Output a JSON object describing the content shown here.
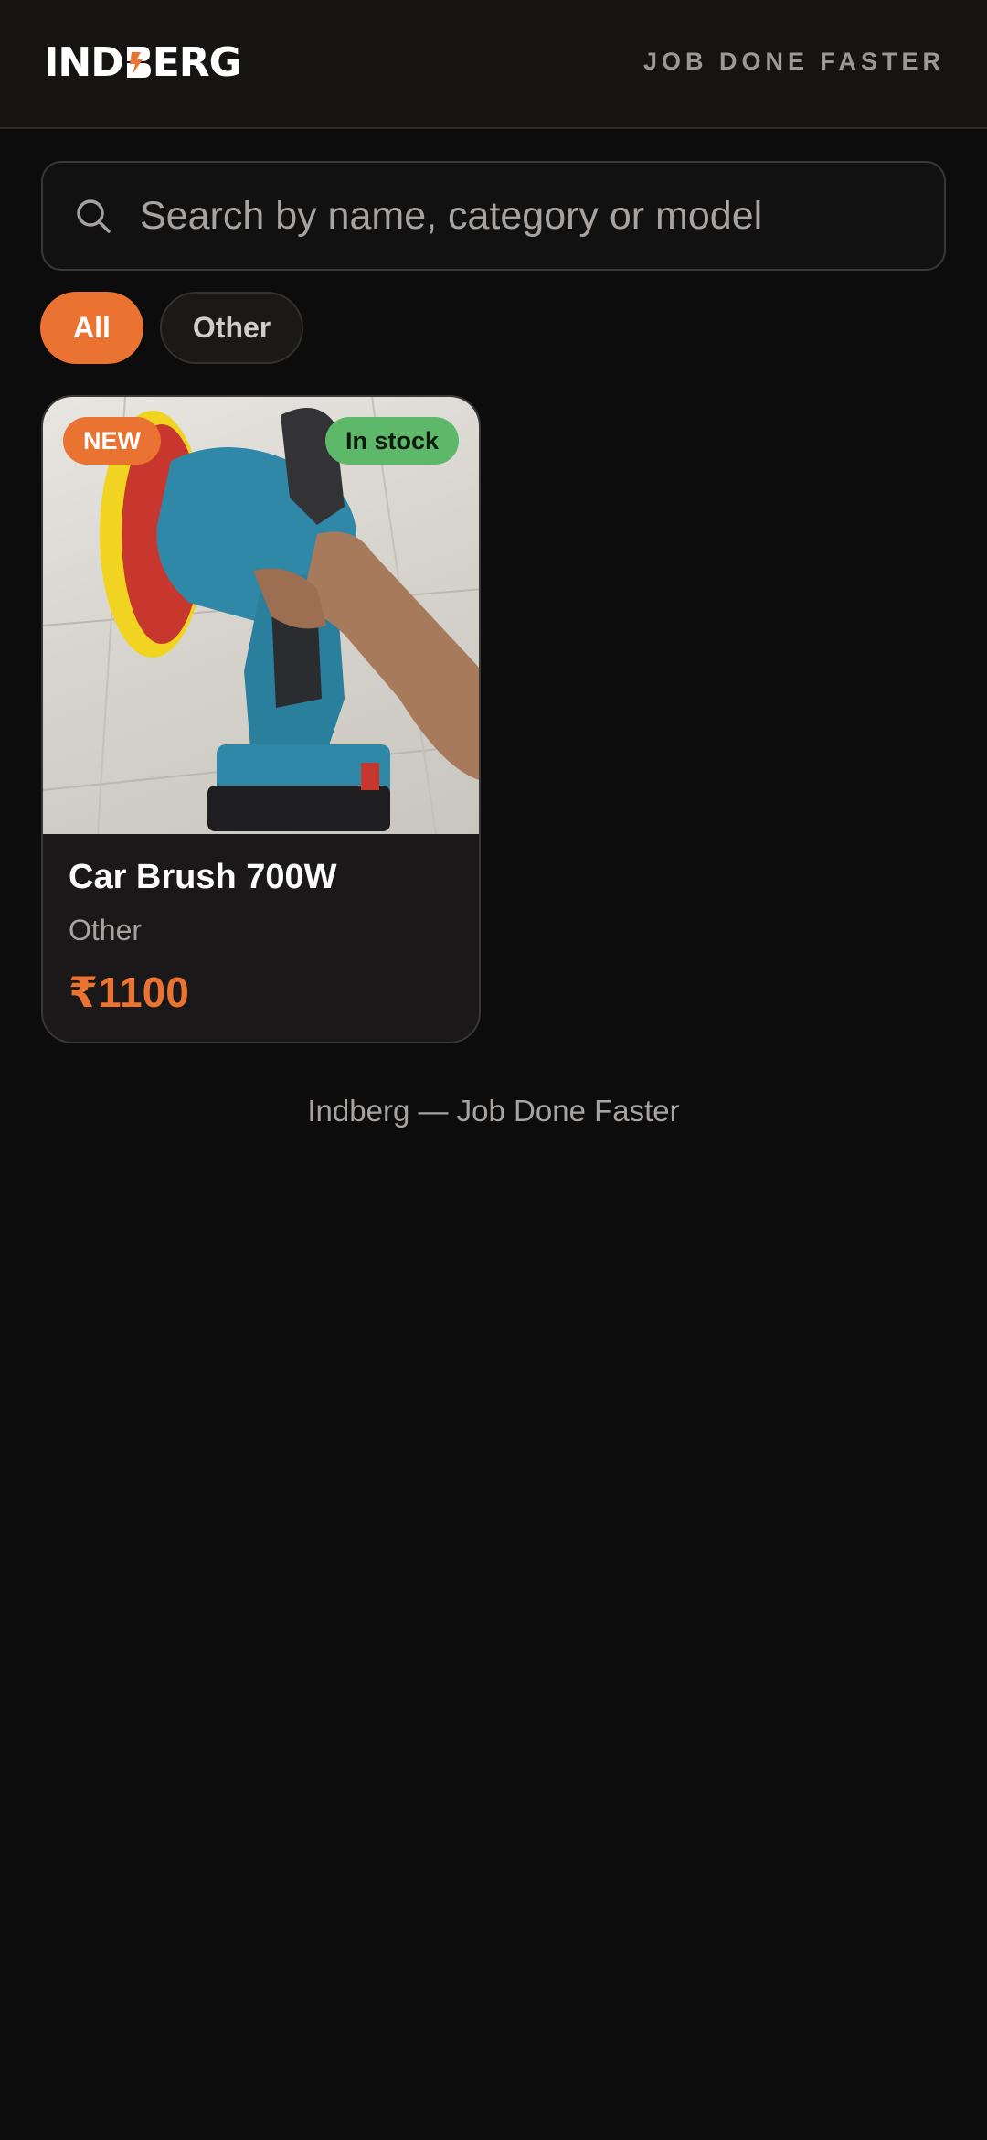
{
  "header": {
    "logo_text_left": "IND",
    "logo_text_right": "ERG",
    "logo_alt": "INDBERG",
    "tagline": "JOB DONE FASTER"
  },
  "search": {
    "placeholder": "Search by name, category or model",
    "value": "",
    "icon": "search-icon"
  },
  "filters": [
    {
      "label": "All",
      "active": true
    },
    {
      "label": "Other",
      "active": false
    }
  ],
  "products": [
    {
      "badge_new": "NEW",
      "badge_stock": "In stock",
      "name": "Car Brush 700W",
      "category": "Other",
      "price": "₹1100"
    }
  ],
  "footer": {
    "text": "Indberg — Job Done Faster"
  },
  "colors": {
    "accent": "#ea7332",
    "in_stock": "#5db86a",
    "background": "#0c0c0c"
  }
}
